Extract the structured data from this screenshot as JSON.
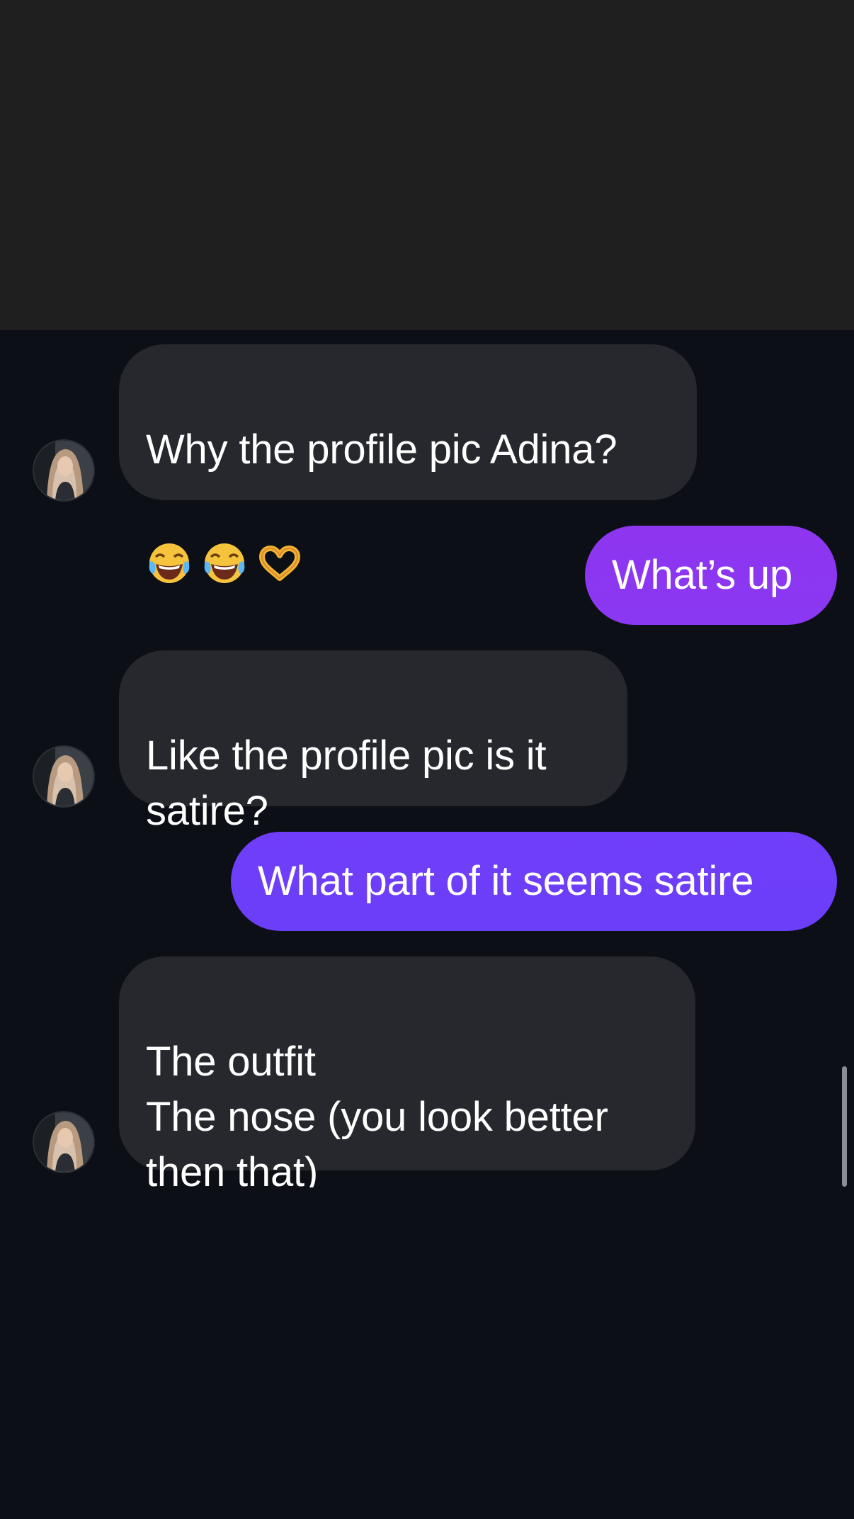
{
  "colors": {
    "header_bg": "#1f1f1f",
    "chat_bg": "#0c0f15",
    "incoming_bubble": "#26282d",
    "outgoing_gradient_start": "#8e35f0",
    "outgoing_gradient_end": "#6a3df8",
    "text": "#ffffff"
  },
  "messages": [
    {
      "direction": "incoming",
      "text": "Why the profile pic Adina?",
      "emojis": [
        "face-with-tears-of-joy-emoji",
        "face-with-tears-of-joy-emoji",
        "heart-hands-emoji"
      ]
    },
    {
      "direction": "outgoing",
      "text": "What’s up"
    },
    {
      "direction": "incoming",
      "text": "Like the profile pic is it\nsatire?"
    },
    {
      "direction": "outgoing",
      "text": "What part of it seems satire"
    },
    {
      "direction": "incoming",
      "text": "The outfit\nThe nose (you look better\nthen that)"
    }
  ]
}
